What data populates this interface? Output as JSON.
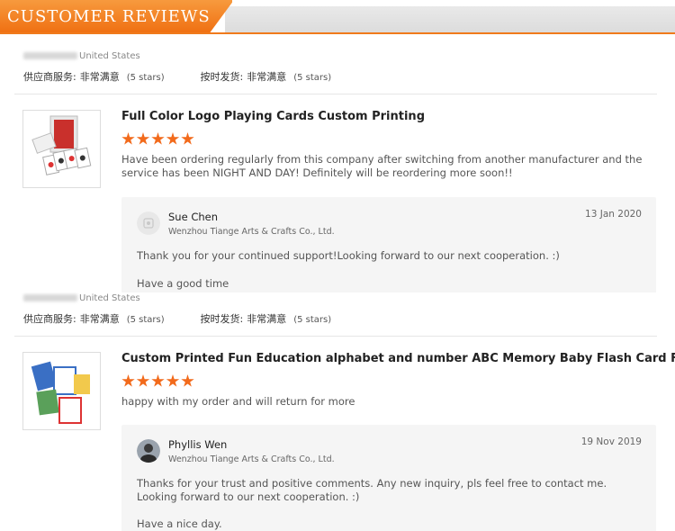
{
  "header": {
    "title": "CUSTOMER REVIEWS"
  },
  "labels": {
    "supplier_service": "供应商服务:",
    "on_time_shipment": "按时发货:",
    "very_satisfied": "非常满意",
    "stars_text": "(5 stars)"
  },
  "reviews": [
    {
      "reviewer_location": "United States",
      "product_title": "Full Color Logo Playing Cards Custom Printing",
      "rating": 5,
      "text": "Have been ordering regularly from this company after switching from another manufacturer and the service has been NIGHT AND DAY! Definitely will be reordering more soon!!",
      "reply": {
        "name": "Sue Chen",
        "company": "Wenzhou Tiange Arts & Crafts Co., Ltd.",
        "date": "13 Jan 2020",
        "message": "Thank you for your continued support!Looking forward to our next cooperation. :)",
        "signoff": "Have a good time"
      }
    },
    {
      "reviewer_location": "United States",
      "product_title": "Custom Printed Fun Education alphabet and number ABC Memory Baby Flash Card For Kids",
      "rating": 5,
      "text": "happy with my order and will return for more",
      "reply": {
        "name": "Phyllis Wen",
        "company": "Wenzhou Tiange Arts & Crafts Co., Ltd.",
        "date": "19 Nov 2019",
        "message": "Thanks for your trust and positive comments. Any new inquiry, pls feel free to contact me. Looking forward to our next cooperation. :)",
        "signoff": "Have a nice day."
      }
    }
  ],
  "colors": {
    "accent": "#f07a1c",
    "star": "#f26a1b",
    "reply_bg": "#f5f5f5"
  }
}
